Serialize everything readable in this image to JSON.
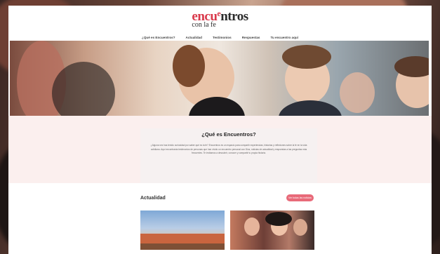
{
  "logo": {
    "part_red": "encu",
    "part_red_small": "e",
    "part_dark": "ntros",
    "subtitle": "con la fe"
  },
  "nav": [
    "¿Qué es Encuentros?",
    "Actualidad",
    "Testimonios",
    "Respuestas",
    "Tu encuentro aquí"
  ],
  "about": {
    "title": "¿Qué es Encuentros?",
    "body": "¿Alguna vez has tenido curiosidad por saber qué es la fe? Encuentros es un espacio para compartir experiencias, historias y reflexiones sobre la fe en la vida cotidiana. Aquí encontrarás testimonios de personas que han vivido un encuentro personal con Dios, noticias de actualidad y respuestas a las preguntas más frecuentes. Te invitamos a descubrir, conocer y compartir tu propia historia."
  },
  "news": {
    "title": "Actualidad",
    "button_label": "Ver todas las noticias"
  },
  "colors": {
    "brand": "#d9394b",
    "button": "#e86a79",
    "about_bg": "#fbefee"
  }
}
